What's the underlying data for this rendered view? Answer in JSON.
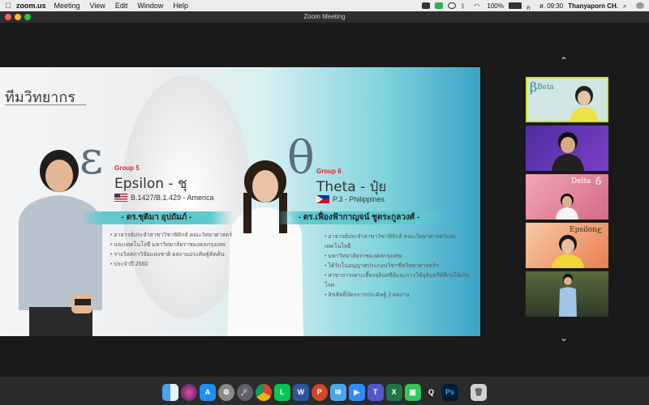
{
  "menubar": {
    "app_name": "zoom.us",
    "items": [
      "Meeting",
      "View",
      "Edit",
      "Window",
      "Help"
    ],
    "battery": "100%",
    "datetime": "ส. 09:30",
    "user": "Thanyaporn CH."
  },
  "window": {
    "title": "Zoom Meeting"
  },
  "slide": {
    "title": "ทีมวิทยากร",
    "left": {
      "greek": "ε",
      "group": "Group 5",
      "name": "Epsilon - ชุ",
      "variant": "B.1427/B.1.429 - America",
      "speaker": "- ดร.ชุติมา อุปถัมภ์ -",
      "bullets": [
        "อาจารย์ประจำสาขาวิชาฟิสิกส์ คณะวิทยาศาสตร์",
        "และเทคโนโลยี มหาวิทยาลัยราชมงคลกรุงเทพ",
        "รางวัลสภาวิจัยแห่งชาติ ผลงานประดิษฐ์คิดค้น",
        "ประจำปี 2560"
      ]
    },
    "right": {
      "greek": "θ",
      "group": "Group 6",
      "name": "Theta - ปุ๋ย",
      "variant": "P.3 - Philippines",
      "speaker": "- ดร.เฟื่องฟ้ากาญจน์ ชูตระกูลวงศ์ -",
      "bullets": [
        "อาจารย์ประจำสาขาวิชาฟิสิกส์ คณะวิทยาศาสตร์และเทคโนโลยี",
        "มหาวิทยาลัยราชมงคลกรุงเทพ",
        "ได้รับโนอนุญาตประกอบวิชาชีพวิทยาศาสตร์ฯ",
        "สาขาการเพาะเลี้ยงจุลินทรีย์และการใช้จุลินทรีย์ที่ก่อให้เกิดโรค",
        "ลิขสิทธิ์บัตรการประดิษฐ์ 2 ผลงาน"
      ]
    }
  },
  "gallery": {
    "tiles": [
      {
        "label": "Beta",
        "symbol": "β",
        "bg": "#c9e3e0"
      },
      {
        "label": "",
        "symbol": "",
        "bg": "#6a3fb0"
      },
      {
        "label": "Delta",
        "symbol": "δ",
        "bg": "#e58a9c"
      },
      {
        "label": "Epsilon",
        "symbol": "ε",
        "bg": "#f3b98f"
      },
      {
        "label": "",
        "symbol": "",
        "bg": "#3b4a2e"
      }
    ]
  },
  "dock": {
    "icons": [
      "finder-icon",
      "siri-icon",
      "app-store-icon",
      "system-prefs-icon",
      "launchpad-icon",
      "chrome-icon",
      "line-icon",
      "word-icon",
      "powerpoint-icon",
      "mail-icon",
      "zoom-icon",
      "teams-icon",
      "excel-icon",
      "facetime-icon",
      "quicktime-icon",
      "photoshop-icon",
      "trash-icon"
    ]
  }
}
